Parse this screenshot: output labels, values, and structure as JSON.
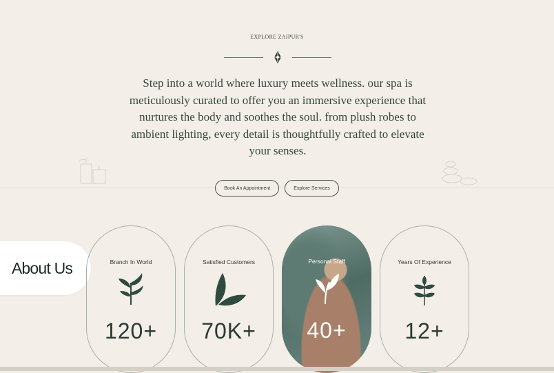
{
  "section": {
    "eyebrow": "EXPLORE ZAIPUR'S",
    "intro": "Step into a world where luxury meets wellness. our spa is meticulously curated to offer you an immersive experience that nurtures the body and soothes the soul. from plush robes to ambient lighting, every detail is thoughtfully crafted to elevate your senses."
  },
  "buttons": {
    "book": "Book An Appointment",
    "explore": "Explore Services"
  },
  "about": {
    "label": "About Us"
  },
  "stats": [
    {
      "label": "Branch In World",
      "value": "120+",
      "icon": "leaf-sprig-icon"
    },
    {
      "label": "Satisfied Customers",
      "value": "70K+",
      "icon": "leaves-icon"
    },
    {
      "label": "Personal Staff",
      "value": "40+",
      "icon": "leaf-icon"
    },
    {
      "label": "Years Of Experience",
      "value": "12+",
      "icon": "herb-icon"
    }
  ],
  "colors": {
    "background": "#f3eee8",
    "text": "#2f3b34",
    "leaf": "#2f4a3e"
  }
}
